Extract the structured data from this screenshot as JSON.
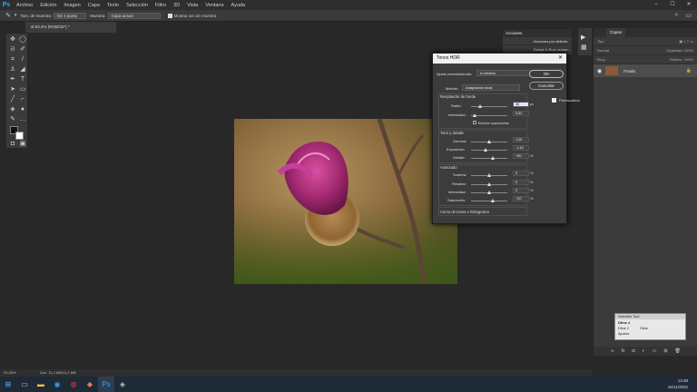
{
  "menubar": {
    "app_logo": "Ps",
    "items": [
      "Archivo",
      "Edición",
      "Imagen",
      "Capa",
      "Texto",
      "Selección",
      "Filtro",
      "3D",
      "Vista",
      "Ventana",
      "Ayuda"
    ]
  },
  "options_bar": {
    "sample_size_label": "Tam. de muestra:",
    "sample_size_value": "De 1 punto",
    "sample_label": "Muestra:",
    "sample_value": "Capa actual",
    "show_ring_label": "Mostrar aro de muestra"
  },
  "document_tab": {
    "title": "al 53,4% (RGB/32*) *"
  },
  "actions_panel": {
    "title": "Acciones",
    "items": [
      "Acciones por defecto",
      "Dodge & Burn autom..."
    ]
  },
  "layers_panel": {
    "tab": "Capas",
    "search_placeholder": "Tipo",
    "blend_mode": "Normal",
    "opacity_label": "Opacidad:",
    "opacity_value": "100%",
    "lock_label": "Bloq.:",
    "fill_label": "Relleno:",
    "fill_value": "100%",
    "layer_name": "Fondo"
  },
  "selective_tool": {
    "title": "Selective Tool",
    "item1": "Dfine 2",
    "item2": "Dfine 2",
    "item3": "Dfine",
    "footer": "Ajustes"
  },
  "dialog": {
    "title": "Tonos HDR",
    "preset_label": "Ajuste preestablecido:",
    "preset_value": "A medida",
    "method_label": "Método:",
    "method_value": "Adaptación local",
    "ok": "OK",
    "cancel": "Cancelar",
    "preview_label": "Previsualizar",
    "sec_edge": {
      "title": "Resplandor de borde",
      "radius_label": "Radio:",
      "radius_value": "38",
      "radius_unit": "px",
      "strength_label": "Intensidad:",
      "strength_value": "0,52",
      "strength_unit": "",
      "smooth_label": "Bordes suavizados"
    },
    "sec_tone": {
      "title": "Tono y detalle",
      "gamma_label": "Gamma:",
      "gamma_value": "1,00",
      "exposure_label": "Exposición:",
      "exposure_value": "-1,15",
      "detail_label": "Detalle:",
      "detail_value": "+50",
      "detail_unit": "%"
    },
    "sec_adv": {
      "title": "Avanzado",
      "shadow_label": "Sombra:",
      "shadow_value": "0",
      "shadow_unit": "%",
      "highlight_label": "Resaltar:",
      "highlight_value": "0",
      "highlight_unit": "%",
      "vibrance_label": "Intensidad:",
      "vibrance_value": "0",
      "vibrance_unit": "%",
      "saturation_label": "Saturación:",
      "saturation_value": "+20",
      "saturation_unit": "%"
    },
    "curve_label": "Curva de tonos e histograma"
  },
  "statusbar": {
    "zoom": "53,35%",
    "doc": "Doc: 11,2 MB/11,2 MB"
  },
  "taskbar": {
    "time": "13:38",
    "date": "15/11/2022"
  },
  "colors": {
    "accent": "#31a8ff",
    "ps_blue": "#001e36"
  }
}
